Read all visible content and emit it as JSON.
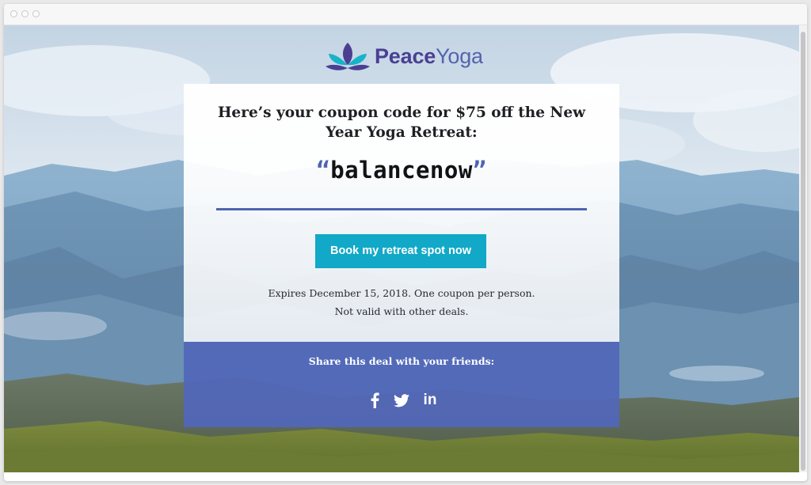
{
  "brand": {
    "name_part1": "Peace",
    "name_part2": "Yoga"
  },
  "coupon": {
    "headline": "Here’s your coupon code for $75 off the New Year Yoga Retreat:",
    "open_quote": "“",
    "code": "balancenow",
    "close_quote": "”",
    "cta_label": "Book my retreat spot now",
    "terms_line1": "Expires December 15, 2018. One coupon per person.",
    "terms_line2": "Not valid with other deals."
  },
  "share": {
    "label": "Share this deal with your friends:",
    "networks": [
      "facebook-icon",
      "twitter-icon",
      "linkedin-icon"
    ],
    "linkedin_glyph": "in"
  },
  "colors": {
    "accent": "#4e63b2",
    "button": "#12a8c8",
    "share_panel": "#5267b9",
    "logo_dark": "#4a3f93",
    "logo_teal": "#16b3c9"
  }
}
